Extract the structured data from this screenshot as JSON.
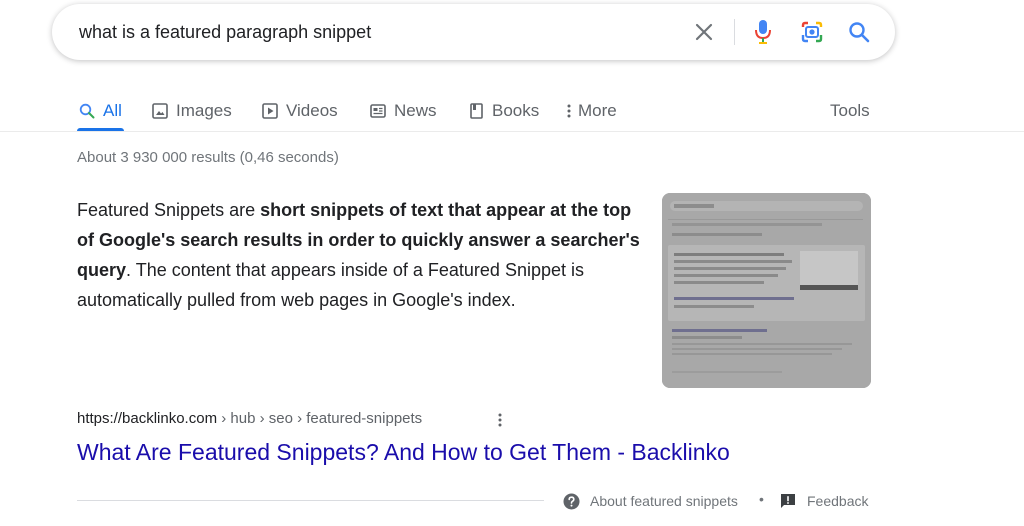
{
  "search": {
    "query": "what is a featured paragraph snippet"
  },
  "tabs": [
    {
      "label": "All",
      "icon": "search-icon",
      "active": true
    },
    {
      "label": "Images",
      "icon": "image-icon"
    },
    {
      "label": "Videos",
      "icon": "video-icon"
    },
    {
      "label": "News",
      "icon": "news-icon"
    },
    {
      "label": "Books",
      "icon": "book-icon"
    },
    {
      "label": "More",
      "icon": "more-vert-icon"
    }
  ],
  "tools_label": "Tools",
  "result_stats": "About 3 930 000 results (0,46 seconds)",
  "snippet": {
    "text_1": "Featured Snippets are ",
    "bold": "short snippets of text that appear at the top of Google's search results in order to quickly answer a searcher's query",
    "text_2": ". The content that appears inside of a Featured Snippet is automatically pulled from web pages in Google's index."
  },
  "result": {
    "domain": "https://backlinko.com",
    "path": " › hub › seo › featured-snippets",
    "title": "What Are Featured Snippets? And How to Get Them - Backlinko"
  },
  "footer": {
    "about_label": "About featured snippets",
    "separator": "•",
    "feedback_label": "Feedback"
  },
  "colors": {
    "link": "#1a0dab",
    "accent": "#1a73e8",
    "secondary_text": "#70757a"
  }
}
